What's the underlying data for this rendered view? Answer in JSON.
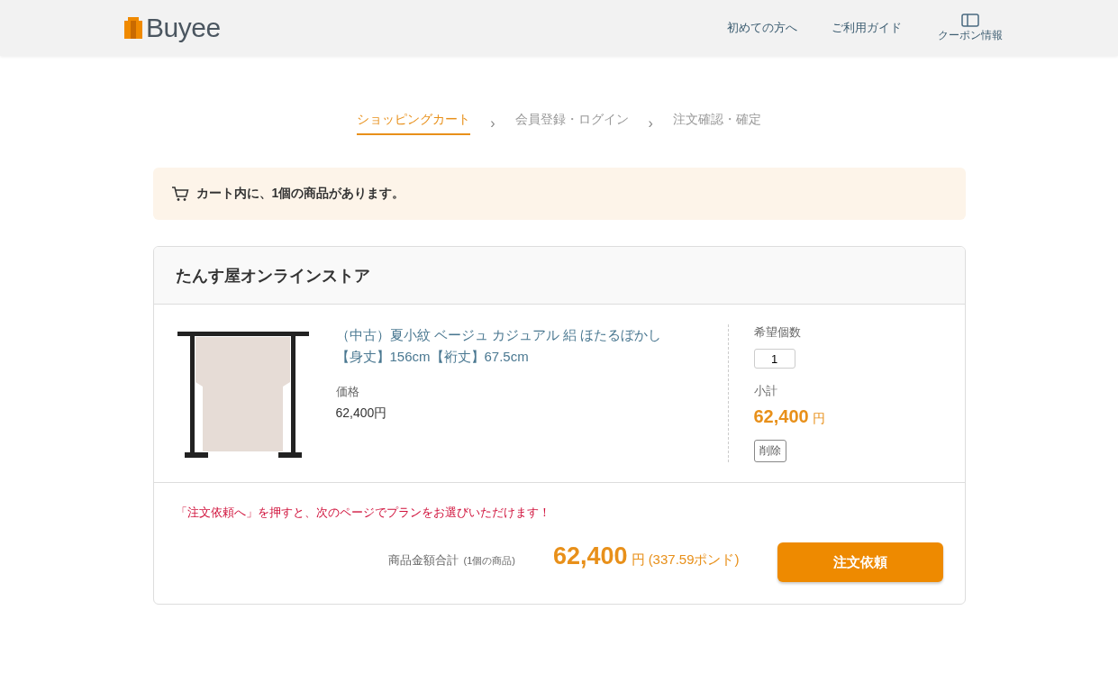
{
  "header": {
    "logo": "Buyee",
    "links": [
      {
        "label": "初めての方へ"
      },
      {
        "label": "ご利用ガイド"
      }
    ],
    "coupon": {
      "label": "クーポン情報"
    }
  },
  "steps": [
    {
      "label": "ショッピングカート",
      "selected": true
    },
    {
      "label": "会員登録・ログイン",
      "selected": false
    },
    {
      "label": "注文確認・確定",
      "selected": false
    }
  ],
  "separator": "›",
  "cart_notice": "カート内に、1個の商品があります。",
  "store": {
    "name": "たんす屋オンラインストア",
    "item": {
      "title": "（中古）夏小紋 ベージュ カジュアル 絽 ほたるぼかし【身丈】156cm【裄丈】67.5cm",
      "price_label": "価格",
      "price": "62,400円",
      "quantity_label": "希望個数",
      "quantity": "1",
      "subtotal_label": "小計",
      "subtotal": "62,400",
      "subtotal_unit": "円",
      "delete": "削除"
    },
    "note": "「注文依頼へ」を押すと、次のページでプランをお選びいただけます！",
    "total_label": "商品金額合計",
    "total_count": "(1個の商品)",
    "total": "62,400",
    "total_unit": "円",
    "total_converted": "(337.59ポンド)",
    "order_button": "注文依頼"
  }
}
